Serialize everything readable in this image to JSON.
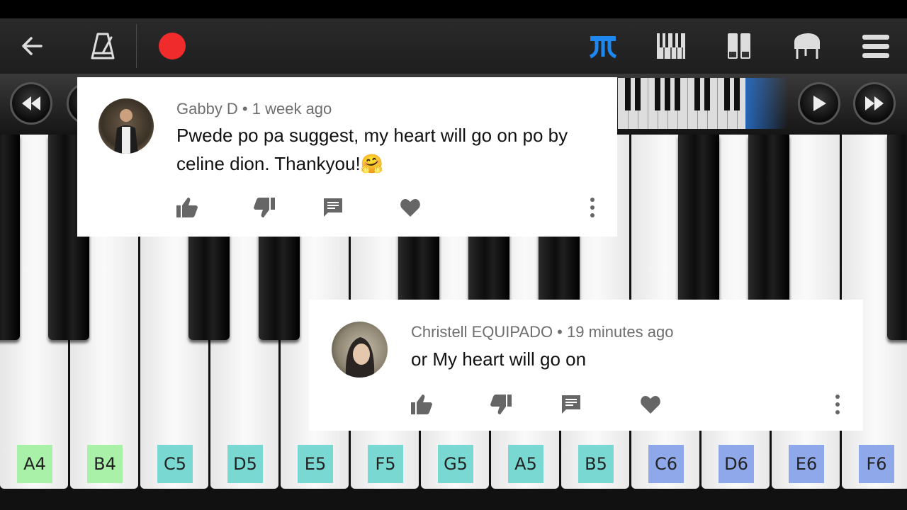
{
  "toolbar": {
    "icons": [
      "back-arrow-icon",
      "metronome-icon",
      "record-icon",
      "piano-game-icon",
      "keyboard-icon",
      "dual-keyboard-icon",
      "grand-piano-icon",
      "menu-icon"
    ],
    "accent_color": "#1e88f0",
    "record_color": "#ef2b2b"
  },
  "keyboard": {
    "labels": [
      {
        "text": "A4",
        "color": "#a9f0a9"
      },
      {
        "text": "B4",
        "color": "#a9f0a9"
      },
      {
        "text": "C5",
        "color": "#7ad8d2"
      },
      {
        "text": "D5",
        "color": "#7ad8d2"
      },
      {
        "text": "E5",
        "color": "#7ad8d2"
      },
      {
        "text": "F5",
        "color": "#7ad8d2"
      },
      {
        "text": "G5",
        "color": "#7ad8d2"
      },
      {
        "text": "A5",
        "color": "#7ad8d2"
      },
      {
        "text": "B5",
        "color": "#7ad8d2"
      },
      {
        "text": "C6",
        "color": "#8fa8ea"
      },
      {
        "text": "D6",
        "color": "#8fa8ea"
      },
      {
        "text": "E6",
        "color": "#8fa8ea"
      },
      {
        "text": "F6",
        "color": "#8fa8ea"
      }
    ]
  },
  "comments": [
    {
      "author": "Gabby D",
      "time": "1 week ago",
      "meta": "Gabby D • 1 week ago",
      "text": "Pwede po pa suggest, my heart will go on po by celine dion. Thankyou!🤗"
    },
    {
      "author": "Christell EQUIPADO",
      "time": "19 minutes ago",
      "meta": "Christell EQUIPADO • 19 minutes ago",
      "text": "or My heart will go on"
    }
  ]
}
